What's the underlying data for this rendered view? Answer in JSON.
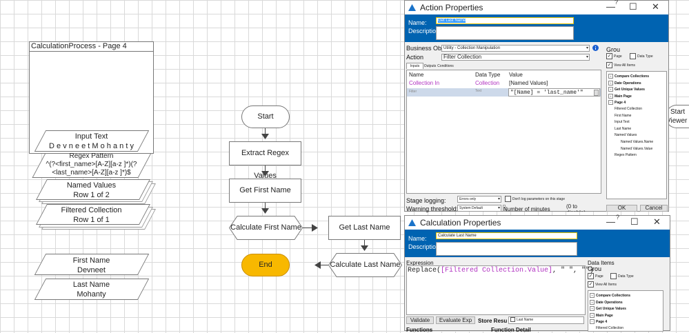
{
  "canvas": {
    "page_title": "CalculationProcess - Page 4",
    "data_items": [
      {
        "name": "Input Text",
        "value": "D e v n e e t M o h a n t y"
      },
      {
        "name": "Regex Pattern",
        "value_line1": "^(?<first_name>[A-Z][a-z ]*)(?",
        "value_line2": "<last_name>[A-Z][a-z ]*)$"
      },
      {
        "name": "Named Values",
        "value": "Row 1 of 2"
      },
      {
        "name": "Filtered Collection",
        "value": "Row 1 of 1"
      },
      {
        "name": "First Name",
        "value": "Devneet"
      },
      {
        "name": "Last Name",
        "value": "Mohanty"
      }
    ],
    "flow": {
      "start": "Start",
      "extract": "Extract Regex Values",
      "get_first": "Get First Name",
      "calc_first": "Calculate First Name",
      "get_last": "Get Last Name",
      "calc_last": "Calculate Last Name",
      "end": "End"
    },
    "right_partial": {
      "start": "Start",
      "viewer": "Viewer"
    }
  },
  "action_dialog": {
    "title": "Action Properties",
    "name_label": "Name:",
    "name_value": "Get Last Name",
    "description_label": "Description:",
    "business_obj_label": "Business Obj",
    "business_obj_value": "Utility - Collection Manipulation",
    "action_label": "Action",
    "action_value": "Filter Collection",
    "tabs": [
      "Inputs",
      "Outputs",
      "Conditions"
    ],
    "columns": [
      "Name",
      "Data Type",
      "Value"
    ],
    "rows": [
      {
        "name": "Collection In",
        "type": "Collection",
        "value": "[Named Values]"
      },
      {
        "name": "Filter",
        "type": "Text",
        "value": "\"[Name] = 'last_name'\""
      }
    ],
    "stage_logging_label": "Stage logging:",
    "stage_logging_value": "Errors only",
    "dont_log_label": "Don't log parameters on this stage",
    "warning_label": "Warning threshold:",
    "warning_value": "System Default",
    "minutes_label": "Number of minutes",
    "disable_label": "(0 to disable)",
    "ok": "OK",
    "cancel": "Cancel",
    "group_label": "Grou",
    "page_cb": "Page",
    "datatype_cb": "Data Type",
    "view_all": "View All Items",
    "tree": [
      {
        "label": "Compare Collections",
        "bold": true,
        "level": 0
      },
      {
        "label": "Date Operations",
        "bold": true,
        "level": 0
      },
      {
        "label": "Get Unique Values",
        "bold": true,
        "level": 0
      },
      {
        "label": "Main Page",
        "bold": true,
        "level": 0
      },
      {
        "label": "Page 4",
        "bold": true,
        "level": 0
      },
      {
        "label": "Filtered Collection",
        "bold": false,
        "level": 1
      },
      {
        "label": "First Name",
        "bold": false,
        "level": 1
      },
      {
        "label": "Input Text",
        "bold": false,
        "level": 1
      },
      {
        "label": "Last Name",
        "bold": false,
        "level": 1
      },
      {
        "label": "Named Values",
        "bold": false,
        "level": 1
      },
      {
        "label": "Named Values.Name",
        "bold": false,
        "level": 2
      },
      {
        "label": "Named Values.Value",
        "bold": false,
        "level": 2
      },
      {
        "label": "Regex Pattern",
        "bold": false,
        "level": 1
      }
    ]
  },
  "calc_dialog": {
    "title": "Calculation Properties",
    "name_label": "Name:",
    "name_value": "Calculate Last Name",
    "description_label": "Description:",
    "expression_label": "Expression",
    "expr_func": "Replace(",
    "expr_field": "[Filtered Collection.Value]",
    "expr_rest": ", \" \", \"\")",
    "data_items_label": "Data Items",
    "group_label": "Grou",
    "page_cb": "Page",
    "datatype_cb": "Data Type",
    "view_all": "View All Items",
    "validate": "Validate",
    "evaluate": "Evaluate Exp",
    "store_label": "Store Resu",
    "store_value": "Last Name",
    "functions_label": "Functions",
    "function_detail_label": "Function Detail",
    "tree": [
      {
        "label": "Compare Collections",
        "bold": true,
        "level": 0
      },
      {
        "label": "Date Operations",
        "bold": true,
        "level": 0
      },
      {
        "label": "Get Unique Values",
        "bold": true,
        "level": 0
      },
      {
        "label": "Main Page",
        "bold": true,
        "level": 0
      },
      {
        "label": "Page 4",
        "bold": true,
        "level": 0
      },
      {
        "label": "Filtered Collection",
        "bold": false,
        "level": 1
      }
    ]
  },
  "colors": {
    "accent": "#0063b1",
    "end_stage": "#f8b800",
    "param_name": "#b030c0"
  }
}
